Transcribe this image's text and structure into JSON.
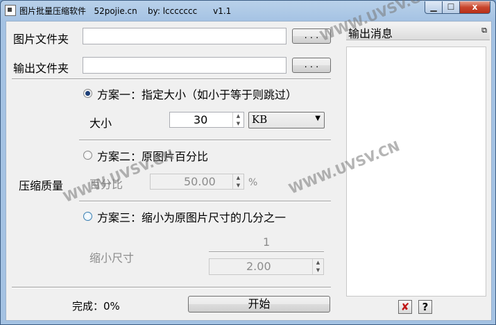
{
  "window": {
    "title": "图片批量压缩软件   52pojie.cn    by: lccccccc      v1.1",
    "minimize": "▁",
    "maximize": "☐",
    "close": "x"
  },
  "input_folder": {
    "label": "图片文件夹",
    "value": "",
    "browse": ". . ."
  },
  "output_folder": {
    "label": "输出文件夹",
    "value": "",
    "browse": ". . ."
  },
  "compress_group_label": "压缩质量",
  "option1": {
    "label": "方案一：指定大小（如小于等于则跳过）",
    "selected": true,
    "size_label": "大小",
    "size_value": "30",
    "unit_selected": "KB"
  },
  "option2": {
    "label": "方案二：原图片百分比",
    "selected": false,
    "percent_label": "百分比",
    "percent_value": "50.00",
    "percent_unit": "%"
  },
  "option3": {
    "label": "方案三：缩小为原图片尺寸的几分之一",
    "selected": false,
    "scale_label": "缩小尺寸",
    "numerator": "1",
    "denominator_value": "2.00"
  },
  "status": {
    "text": "完成：0%"
  },
  "start_button": "开始",
  "output_panel": {
    "title": "输出消息",
    "float_icon": "⧉"
  },
  "bottom_icons": {
    "close": "✘",
    "help": "?"
  },
  "watermarks": [
    "WWW.UVSV.CN",
    "WWW.UVSV.CN",
    "WWW.UVSV.CN"
  ]
}
